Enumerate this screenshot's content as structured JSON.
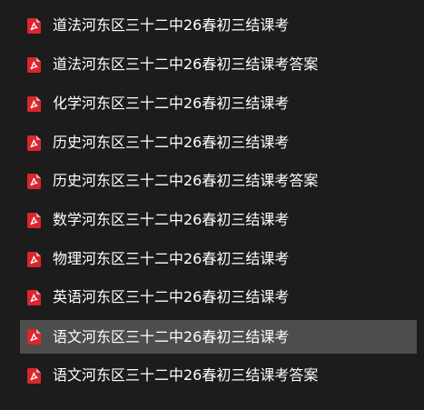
{
  "file_list": {
    "items": [
      {
        "name": "道法河东区三十二中26春初三结课考",
        "icon": "pdf-icon",
        "selected": false
      },
      {
        "name": "道法河东区三十二中26春初三结课考答案",
        "icon": "pdf-icon",
        "selected": false
      },
      {
        "name": "化学河东区三十二中26春初三结课考",
        "icon": "pdf-icon",
        "selected": false
      },
      {
        "name": "历史河东区三十二中26春初三结课考",
        "icon": "pdf-icon",
        "selected": false
      },
      {
        "name": "历史河东区三十二中26春初三结课考答案",
        "icon": "pdf-icon",
        "selected": false
      },
      {
        "name": "数学河东区三十二中26春初三结课考",
        "icon": "pdf-icon",
        "selected": false
      },
      {
        "name": "物理河东区三十二中26春初三结课考",
        "icon": "pdf-icon",
        "selected": false
      },
      {
        "name": "英语河东区三十二中26春初三结课考",
        "icon": "pdf-icon",
        "selected": false
      },
      {
        "name": "语文河东区三十二中26春初三结课考",
        "icon": "pdf-icon",
        "selected": true
      },
      {
        "name": "语文河东区三十二中26春初三结课考答案",
        "icon": "pdf-icon",
        "selected": false
      }
    ]
  },
  "colors": {
    "background": "#1c1c1c",
    "selected_background": "#4d4d4d",
    "text": "#ffffff",
    "pdf_icon": "#d9262c"
  }
}
